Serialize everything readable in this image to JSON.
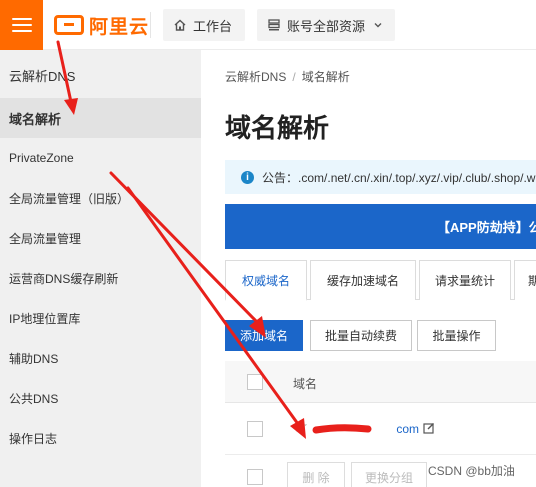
{
  "brand": {
    "logo_text": "阿里云",
    "accent": "#ff6a00"
  },
  "topbar": {
    "workbench_label": "工作台",
    "resource_label": "账号全部资源"
  },
  "sidebar": {
    "title": "云解析DNS",
    "items": [
      {
        "label": "域名解析",
        "active": true
      },
      {
        "label": "PrivateZone"
      },
      {
        "label": "全局流量管理（旧版）"
      },
      {
        "label": "全局流量管理"
      },
      {
        "label": "运营商DNS缓存刷新"
      },
      {
        "label": "IP地理位置库"
      },
      {
        "label": "辅助DNS"
      },
      {
        "label": "公共DNS"
      },
      {
        "label": "操作日志"
      }
    ]
  },
  "breadcrumb": {
    "root": "云解析DNS",
    "sep": "/",
    "current": "域名解析"
  },
  "page_title": "域名解析",
  "notice": {
    "label": "公告：",
    "text": ".com/.net/.cn/.xin/.top/.xyz/.vip/.club/.shop/.w"
  },
  "banner": {
    "text": "【APP防劫持】公"
  },
  "tabs": [
    {
      "label": "权威域名",
      "active": true
    },
    {
      "label": "缓存加速域名"
    },
    {
      "label": "请求量统计"
    },
    {
      "label": "期"
    }
  ],
  "toolbar": {
    "add_label": "添加域名",
    "auto_renew_label": "批量自动续费",
    "batch_label": "批量操作"
  },
  "table": {
    "column_domain": "域名",
    "row_domain_suffix": "com"
  },
  "footer": {
    "delete_label": "删 除",
    "change_group_label": "更换分组"
  },
  "watermark": "CSDN @bb加油"
}
